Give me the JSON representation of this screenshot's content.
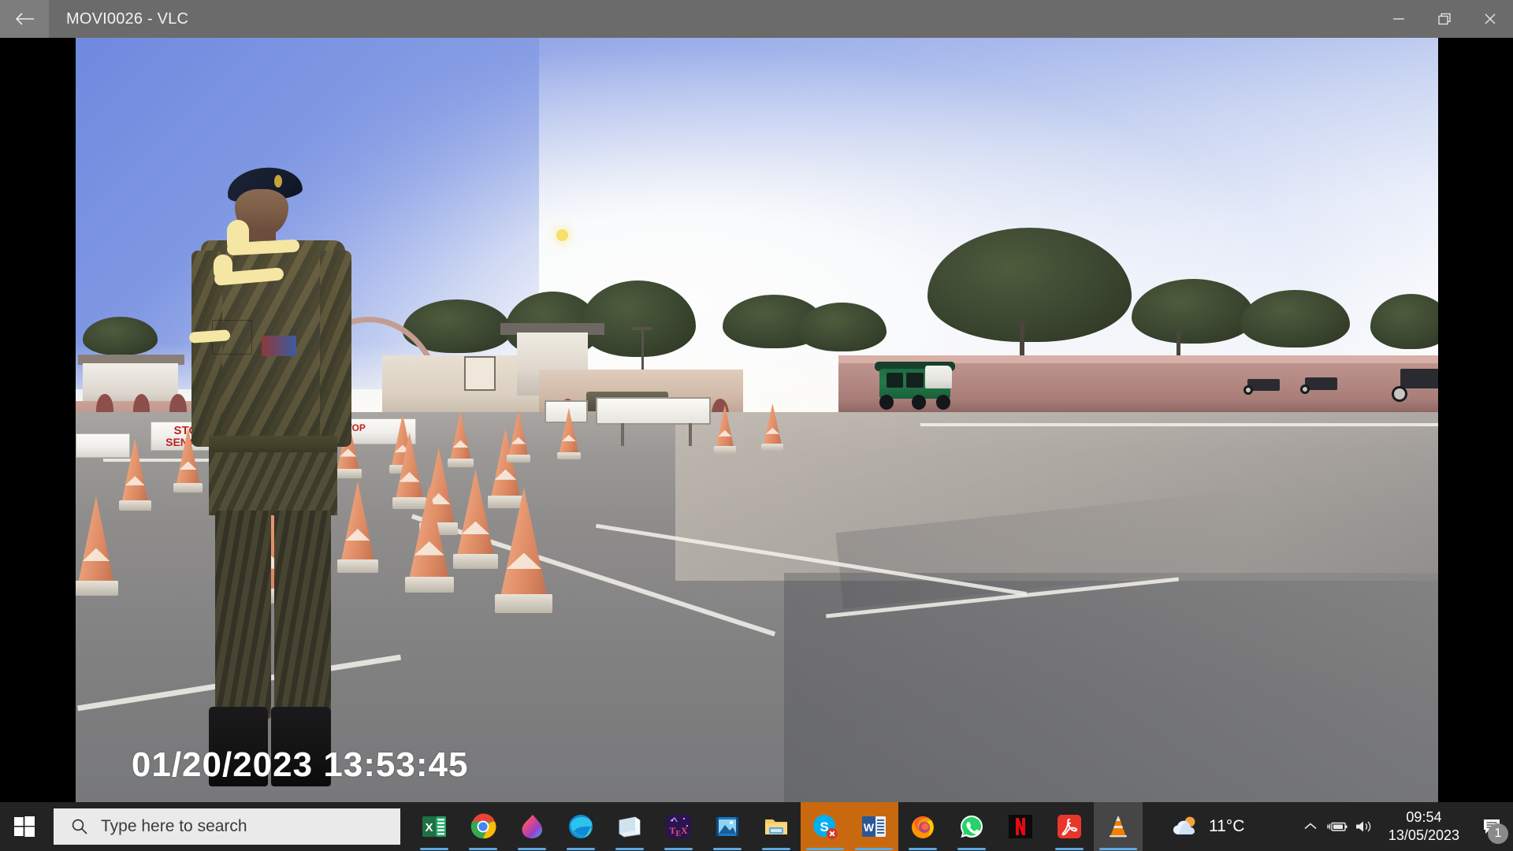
{
  "window": {
    "title": "MOVI0026 - VLC",
    "back_icon": "back-arrow-icon",
    "minimize_label": "Minimize",
    "maximize_label": "Restore",
    "close_label": "Close",
    "titlebar_color": "#6b6b6b"
  },
  "video": {
    "timestamp_overlay": "01/20/2023  13:53:45",
    "scene_description": "Soldier in camouflage uniform and beret standing at an army checkpoint gate with orange traffic cones, auto-rickshaw and boundary wall",
    "annotations": {
      "color": "#f5e7a3",
      "note": "yellow marker scribbles over face and shoulder"
    },
    "signs": {
      "stop": "STOP",
      "sena": "SENA P"
    }
  },
  "taskbar": {
    "start_icon": "windows-logo-icon",
    "search": {
      "icon": "search-icon",
      "placeholder": "Type here to search",
      "value": ""
    },
    "apps": [
      {
        "name": "excel",
        "label": "Excel",
        "state": "pinned-open"
      },
      {
        "name": "chrome",
        "label": "Google Chrome",
        "state": "pinned-open"
      },
      {
        "name": "krita",
        "label": "Krita",
        "state": "pinned-open"
      },
      {
        "name": "edge",
        "label": "Microsoft Edge",
        "state": "pinned-open"
      },
      {
        "name": "sticky-notes",
        "label": "Sticky Notes",
        "state": "pinned-open"
      },
      {
        "name": "texstudio",
        "label": "TeXstudio",
        "state": "pinned-open"
      },
      {
        "name": "movies-tv",
        "label": "Movies & TV",
        "state": "pinned-open"
      },
      {
        "name": "file-explorer",
        "label": "File Explorer",
        "state": "pinned-open"
      },
      {
        "name": "skype",
        "label": "Skype",
        "state": "active"
      },
      {
        "name": "word",
        "label": "Word",
        "state": "active"
      },
      {
        "name": "firefox",
        "label": "Mozilla Firefox",
        "state": "pinned-open"
      },
      {
        "name": "whatsapp",
        "label": "WhatsApp",
        "state": "pinned-open"
      },
      {
        "name": "netflix",
        "label": "Netflix",
        "state": "pinned"
      },
      {
        "name": "acrobat",
        "label": "Adobe Acrobat",
        "state": "pinned-open"
      },
      {
        "name": "vlc",
        "label": "VLC media player",
        "state": "focused"
      }
    ],
    "weather": {
      "icon": "partly-cloudy-icon",
      "temperature": "11°C"
    },
    "tray": {
      "show_hidden_icons": "chevron-up-icon",
      "battery": "battery-charging-icon",
      "volume": "speaker-icon"
    },
    "clock": {
      "time": "09:54",
      "date": "13/05/2023"
    },
    "notifications": {
      "icon": "action-center-icon",
      "count": "1"
    }
  }
}
